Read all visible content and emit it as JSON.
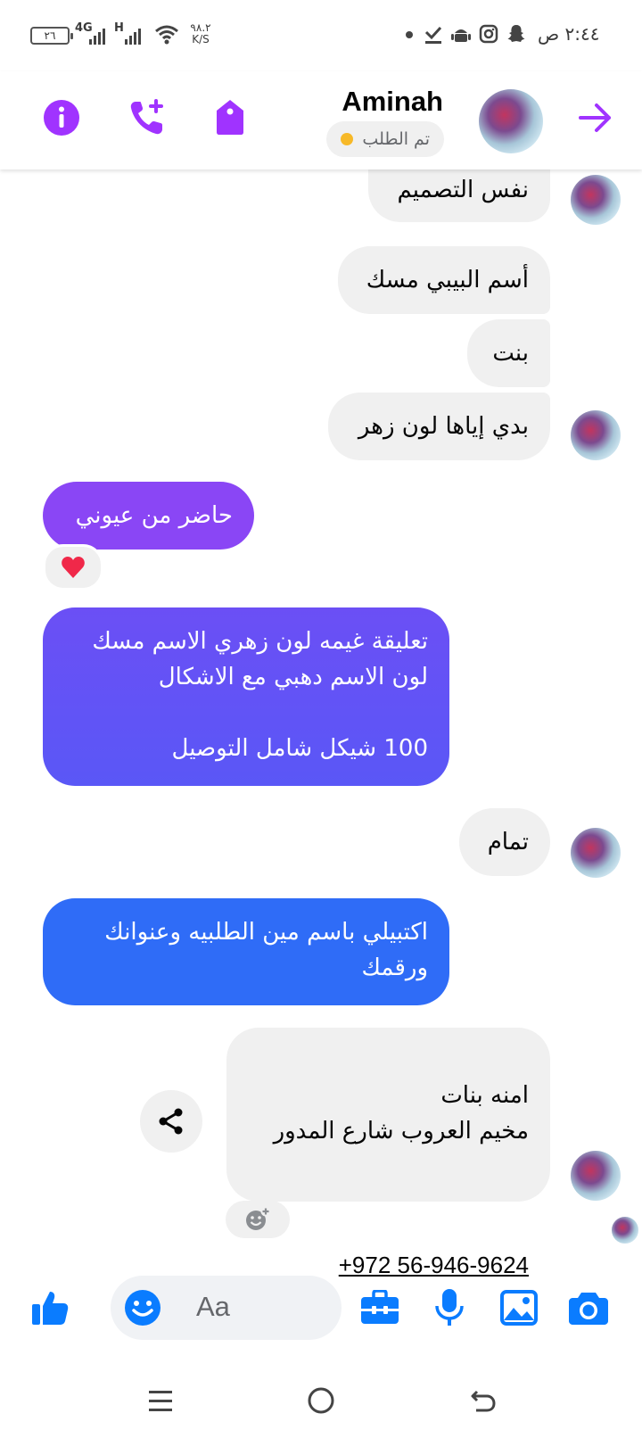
{
  "status_bar": {
    "time": "٢:٤٤ ص",
    "battery": "٢٦",
    "network_1": "4G",
    "network_2": "H",
    "speed_value": "٩٨.٢",
    "speed_unit": "K/S"
  },
  "header": {
    "contact_name": "Aminah",
    "contact_status": "تم الطلب",
    "status_dot_color": "#f7b928",
    "accent_color": "#a033ff",
    "icons": [
      "back-arrow-icon",
      "info-icon",
      "add-call-icon",
      "tag-icon"
    ]
  },
  "messages": [
    {
      "sender": "contact",
      "text": "نفس التصميم"
    },
    {
      "sender": "contact",
      "text": "أسم البيبي مسك"
    },
    {
      "sender": "contact",
      "text": "بنت"
    },
    {
      "sender": "contact",
      "text": "بدي إياها لون زهر"
    },
    {
      "sender": "me",
      "text": "حاضر من عيوني",
      "reaction": "❤️"
    },
    {
      "sender": "me",
      "text": "تعليقة غيمه لون زهري الاسم مسك\nلون الاسم دهبي مع الاشكال\n\n100 شيكل شامل التوصيل"
    },
    {
      "sender": "contact",
      "text": "تمام"
    },
    {
      "sender": "me",
      "text": "اكتبيلي باسم مين الطلبيه وعنوانك\nورقمك"
    },
    {
      "sender": "contact",
      "text": "امنه بنات\nمخيم العروب شارع المدور",
      "phone": "+972 56-946-9624"
    }
  ],
  "composer": {
    "placeholder": "Aa",
    "accent_color": "#0a7cff",
    "icons": [
      "like-icon",
      "emoji-icon",
      "toolbox-icon",
      "microphone-icon",
      "gallery-icon",
      "camera-icon"
    ]
  },
  "nav_bar": {
    "icons": [
      "recent-apps-icon",
      "home-icon",
      "back-icon"
    ]
  }
}
